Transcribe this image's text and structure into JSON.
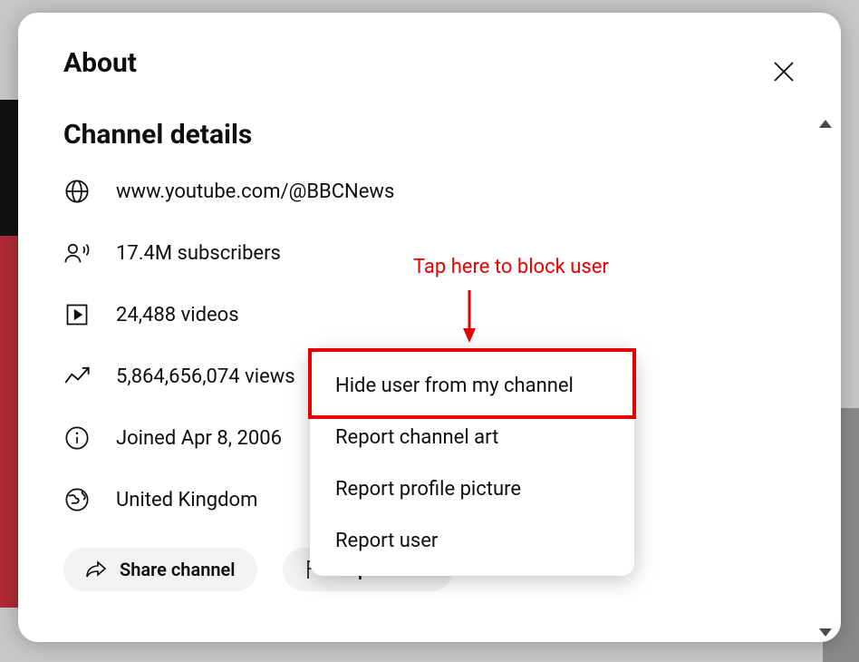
{
  "dialog": {
    "title": "About",
    "section_title": "Channel details",
    "details": {
      "url": "www.youtube.com/@BBCNews",
      "subscribers": "17.4M subscribers",
      "videos": "24,488 videos",
      "views": "5,864,656,074 views",
      "joined": "Joined Apr 8, 2006",
      "country": "United Kingdom"
    },
    "actions": {
      "share_label": "Share channel",
      "report_label": "Report user"
    }
  },
  "popup": {
    "items": [
      "Hide user from my channel",
      "Report channel art",
      "Report profile picture",
      "Report user"
    ]
  },
  "annotation": {
    "text": "Tap here to block user"
  }
}
